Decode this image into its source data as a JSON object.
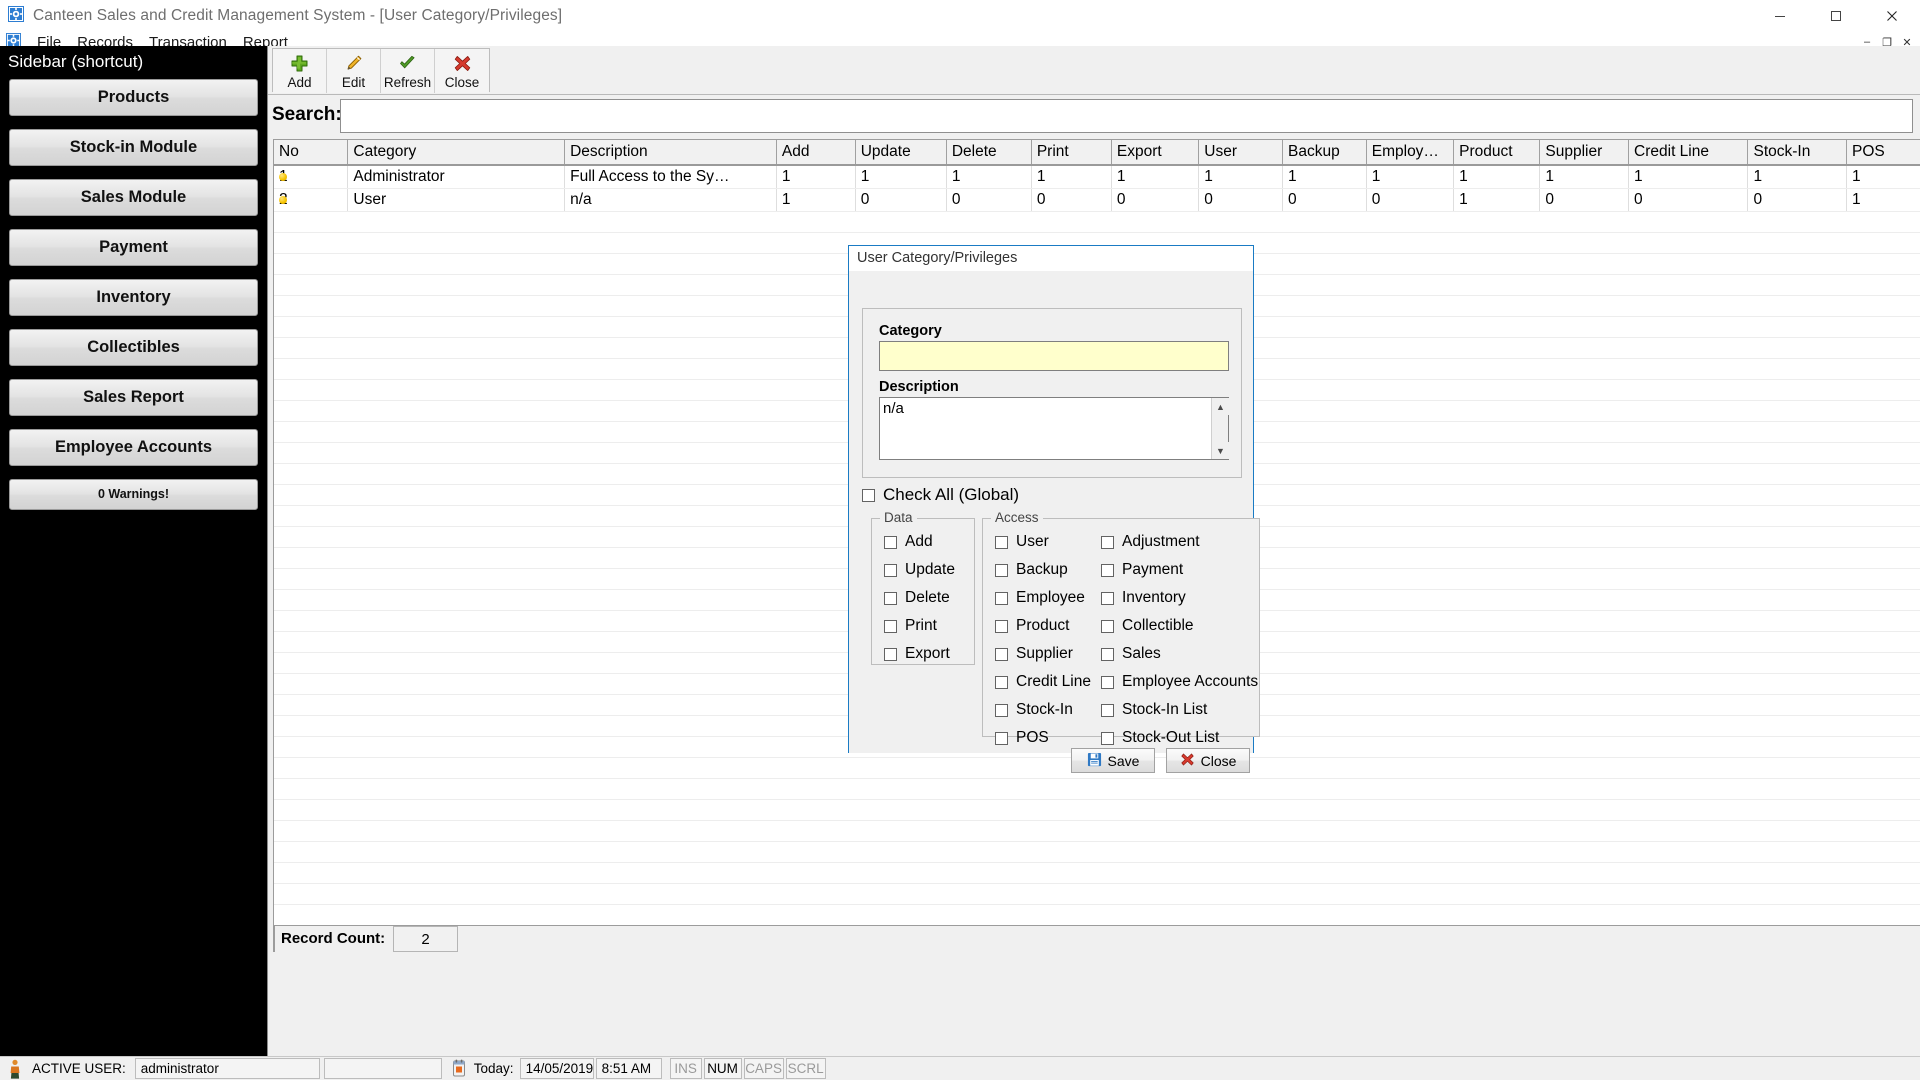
{
  "window": {
    "title": "Canteen Sales and Credit Management System - [User Category/Privileges]",
    "icon": "app-gear-icon",
    "minimize_label": "—",
    "maximize_label": "☐",
    "close_label": "✕"
  },
  "menubar": {
    "icon": "mdi-gear-icon",
    "items": [
      {
        "label": "File"
      },
      {
        "label": "Records"
      },
      {
        "label": "Transaction"
      },
      {
        "label": "Report"
      }
    ],
    "mdi_buttons": [
      {
        "name": "mdi-minimize",
        "label": "–"
      },
      {
        "name": "mdi-restore",
        "label": "❐"
      },
      {
        "name": "mdi-close",
        "label": "✕"
      }
    ]
  },
  "sidebar": {
    "title": "Sidebar (shortcut)",
    "buttons": [
      {
        "label": "Products"
      },
      {
        "label": "Stock-in Module"
      },
      {
        "label": "Sales Module"
      },
      {
        "label": "Payment"
      },
      {
        "label": "Inventory"
      },
      {
        "label": "Collectibles"
      },
      {
        "label": "Sales Report"
      },
      {
        "label": "Employee Accounts"
      }
    ],
    "warning_button": {
      "label": "0 Warnings!"
    }
  },
  "toolbar": {
    "buttons": [
      {
        "label": "Add",
        "icon": "plus-icon"
      },
      {
        "label": "Edit",
        "icon": "pencil-icon"
      },
      {
        "label": "Refresh",
        "icon": "check-icon"
      },
      {
        "label": "Close",
        "icon": "red-x-icon"
      }
    ]
  },
  "search": {
    "label": "Search:",
    "value": "",
    "placeholder": ""
  },
  "grid": {
    "columns": [
      "No",
      "Category",
      "Description",
      "Add",
      "Update",
      "Delete",
      "Print",
      "Export",
      "User",
      "Backup",
      "Employ…",
      "Product",
      "Supplier",
      "Credit Line",
      "Stock-In",
      "POS"
    ],
    "rows": [
      {
        "no": "1",
        "cells": [
          "Administrator",
          "Full Access to the Sy…",
          "1",
          "1",
          "1",
          "1",
          "1",
          "1",
          "1",
          "1",
          "1",
          "1",
          "1",
          "1",
          "1"
        ]
      },
      {
        "no": "2",
        "cells": [
          "User",
          "n/a",
          "1",
          "0",
          "0",
          "0",
          "0",
          "0",
          "0",
          "0",
          "1",
          "0",
          "0",
          "0",
          "1"
        ]
      }
    ]
  },
  "record_count": {
    "label": "Record Count:",
    "value": "2"
  },
  "dialog": {
    "title": "User Category/Privileges",
    "category": {
      "label": "Category",
      "value": "",
      "placeholder": ""
    },
    "description": {
      "label": "Description",
      "value": "n/a",
      "placeholder": ""
    },
    "check_all": {
      "label": "Check All (Global)",
      "checked": false
    },
    "data_group": {
      "legend": "Data",
      "items": [
        {
          "label": "Add",
          "checked": false
        },
        {
          "label": "Update",
          "checked": false
        },
        {
          "label": "Delete",
          "checked": false
        },
        {
          "label": "Print",
          "checked": false
        },
        {
          "label": "Export",
          "checked": false
        }
      ]
    },
    "access_group": {
      "legend": "Access",
      "column_left": [
        {
          "label": "User",
          "checked": false
        },
        {
          "label": "Backup",
          "checked": false
        },
        {
          "label": "Employee",
          "checked": false
        },
        {
          "label": "Product",
          "checked": false
        },
        {
          "label": "Supplier",
          "checked": false
        },
        {
          "label": "Credit Line",
          "checked": false
        },
        {
          "label": "Stock-In",
          "checked": false
        },
        {
          "label": "POS",
          "checked": false
        }
      ],
      "column_right": [
        {
          "label": "Adjustment",
          "checked": false
        },
        {
          "label": "Payment",
          "checked": false
        },
        {
          "label": "Inventory",
          "checked": false
        },
        {
          "label": "Collectible",
          "checked": false
        },
        {
          "label": "Sales",
          "checked": false
        },
        {
          "label": "Employee Accounts",
          "checked": false
        },
        {
          "label": "Stock-In List",
          "checked": false
        },
        {
          "label": "Stock-Out List",
          "checked": false
        }
      ]
    },
    "buttons": [
      {
        "label": "Save",
        "icon": "floppy-save-icon",
        "accel": "S"
      },
      {
        "label": "Close",
        "icon": "red-x-icon",
        "accel": "C"
      }
    ]
  },
  "statusbar": {
    "user_icon": "person-icon",
    "active_user_label": "ACTIVE USER:",
    "active_user_value": "administrator",
    "blank_panel": "",
    "calendar_icon": "calendar-icon",
    "today_label": "Today:",
    "date": "14/05/2019",
    "time": "8:51 AM",
    "indicators": [
      {
        "label": "INS",
        "active": false
      },
      {
        "label": "NUM",
        "active": true
      },
      {
        "label": "CAPS",
        "active": false
      },
      {
        "label": "SCRL",
        "active": false
      }
    ]
  },
  "colors": {
    "sidebar_bg": "#000000",
    "panel_bg": "#f0f0f0",
    "dialog_border": "#1a7bc4",
    "category_field_bg": "#ffffcc",
    "row_dot": "#f6c400"
  }
}
